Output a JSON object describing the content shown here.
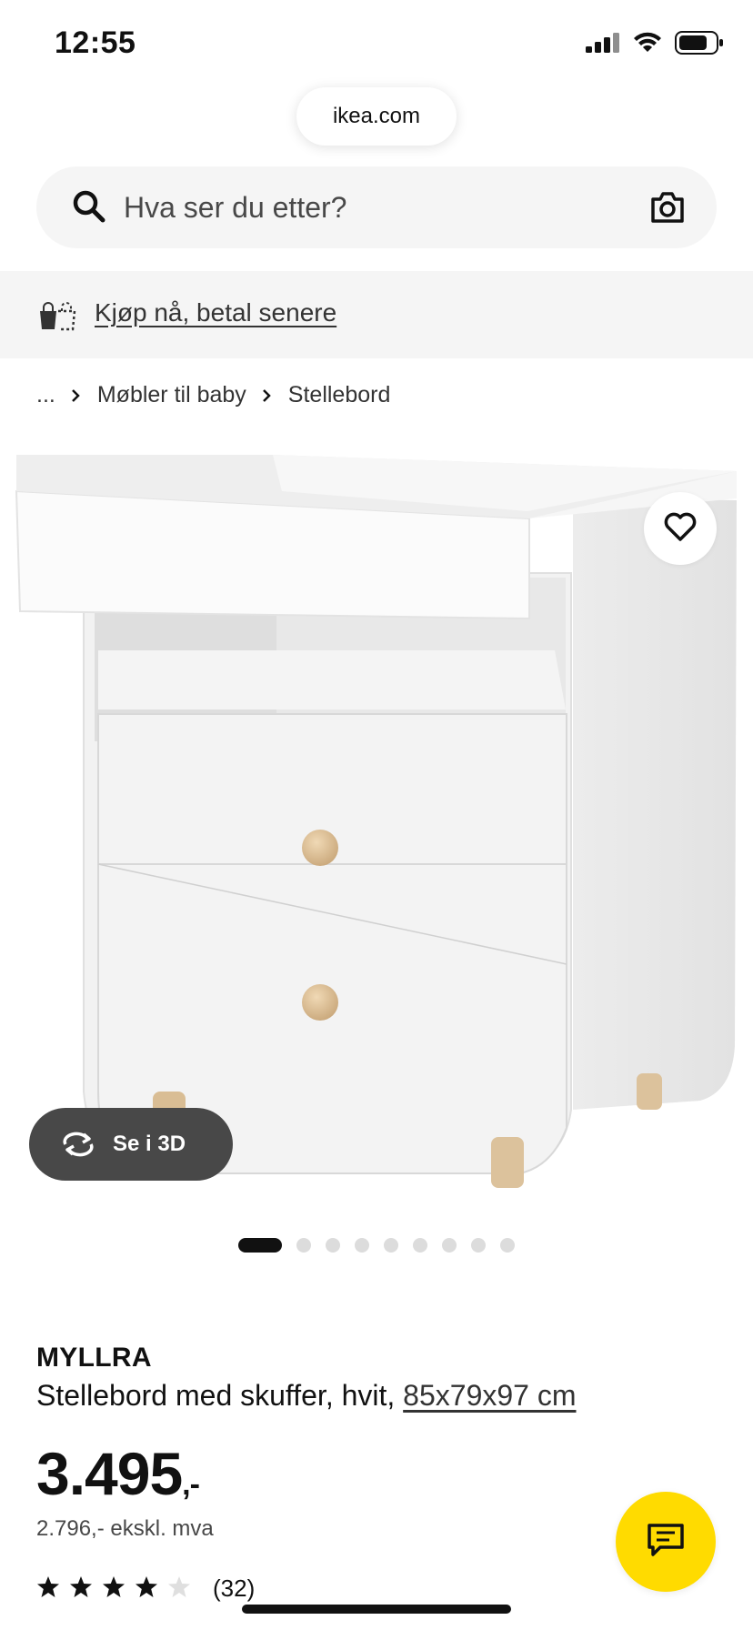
{
  "status_bar": {
    "time": "12:55",
    "icons": [
      "signal-icon",
      "wifi-icon",
      "battery-icon"
    ]
  },
  "browser": {
    "url": "ikea.com"
  },
  "search": {
    "placeholder": "Hva ser du etter?",
    "value": "",
    "icons": [
      "search-icon",
      "camera-icon"
    ]
  },
  "banner": {
    "link_label": "Kjøp nå, betal senere",
    "icon": "shopping-bag-icon"
  },
  "breadcrumb": {
    "items": [
      "...",
      "Møbler til baby",
      "Stellebord"
    ]
  },
  "gallery": {
    "view_3d_label": "Se i 3D",
    "image_count": 9,
    "active_index": 0
  },
  "product": {
    "name": "MYLLRA",
    "description": "Stellebord med skuffer, hvit, ",
    "size_link": "85x79x97 cm",
    "price": "3.495",
    "price_suffix": ",-",
    "price_ex_vat": "2.796,- ekskl. mva",
    "rating": 4,
    "rating_max": 5,
    "review_count": "(32)"
  },
  "colors": {
    "accent_yellow": "#ffdb00",
    "dark": "#111111",
    "button_grey": "#484848"
  }
}
